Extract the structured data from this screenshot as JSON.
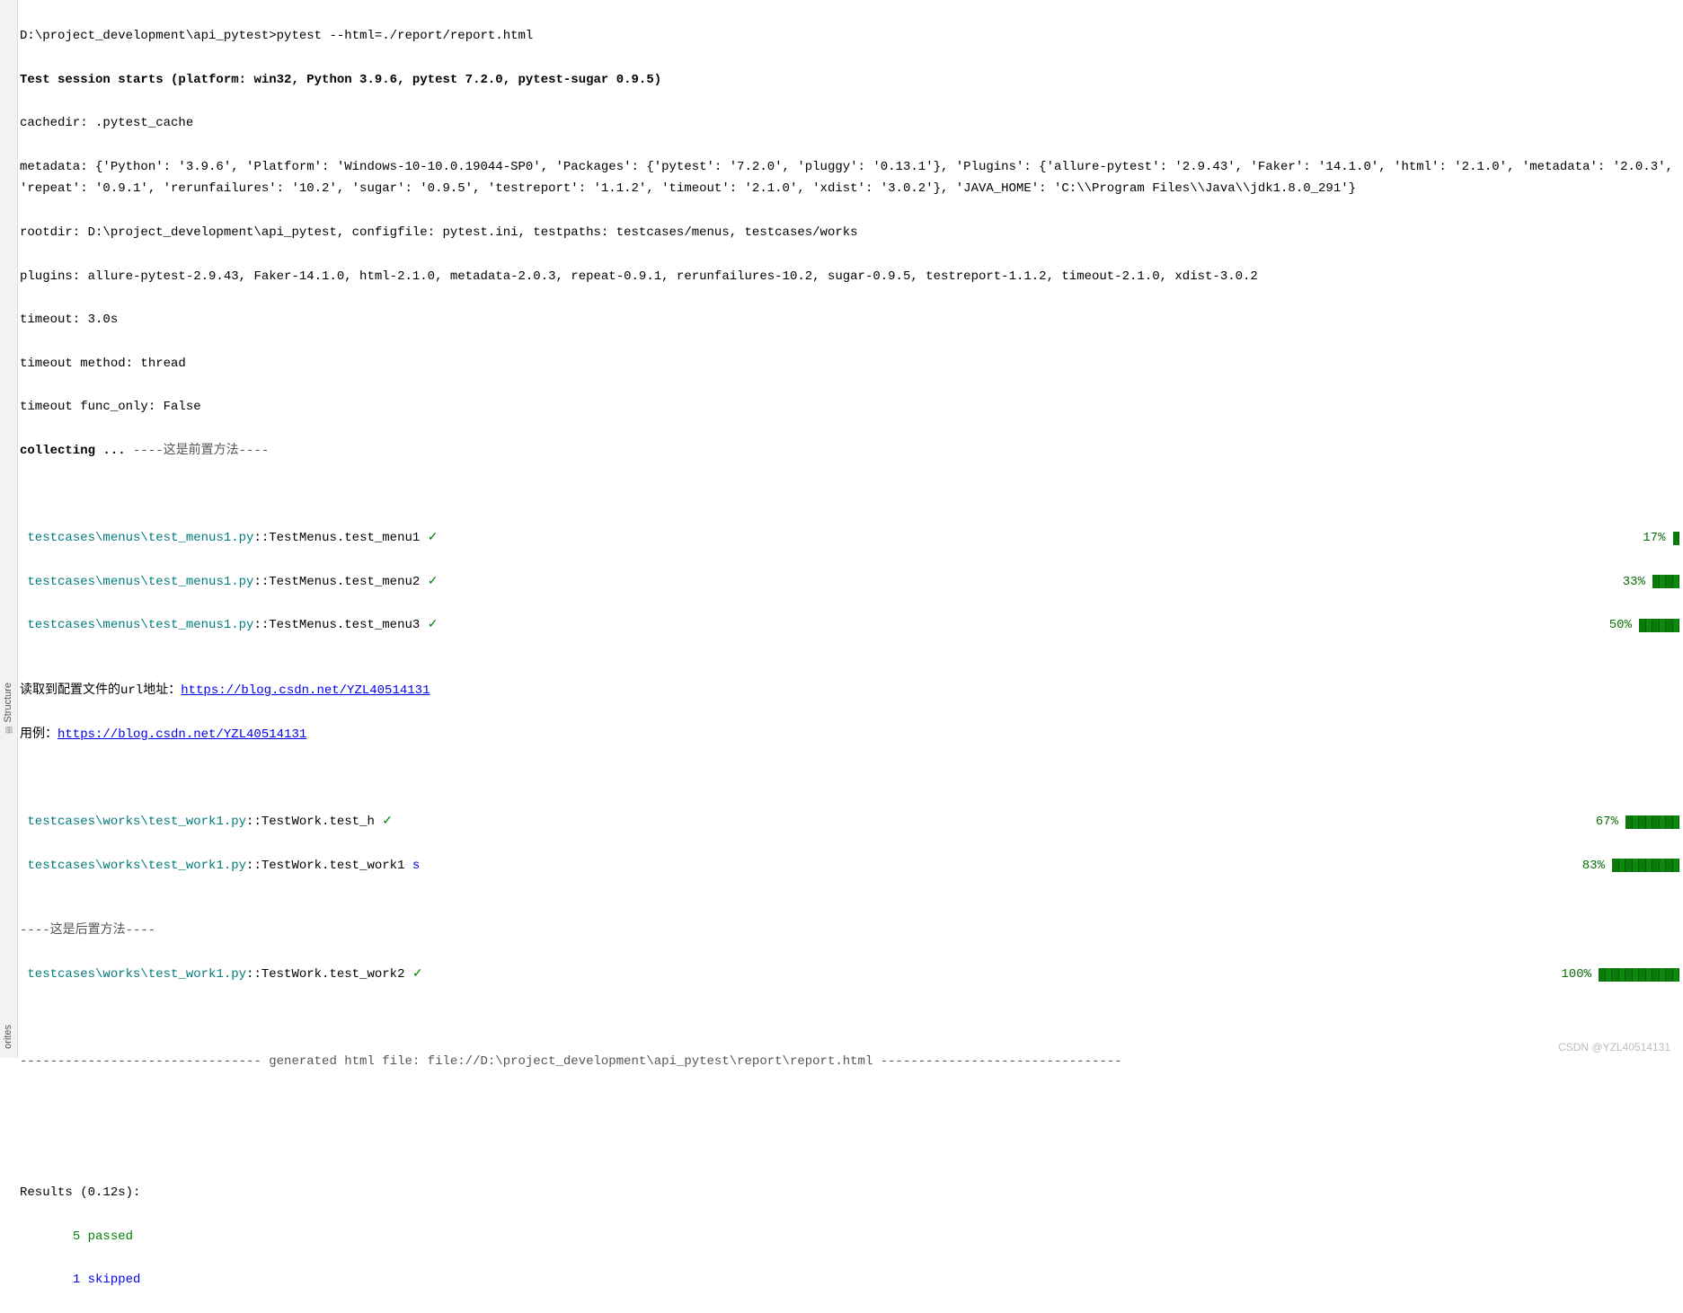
{
  "sidebar": {
    "structure": "Structure",
    "favorites": "orites"
  },
  "cmd": {
    "prompt": "D:\\project_development\\api_pytest>",
    "command": "pytest --html=./report/report.html"
  },
  "session": "Test session starts (platform: win32, Python 3.9.6, pytest 7.2.0, pytest-sugar 0.9.5)",
  "cachedir": "cachedir: .pytest_cache",
  "metadata": "metadata: {'Python': '3.9.6', 'Platform': 'Windows-10-10.0.19044-SP0', 'Packages': {'pytest': '7.2.0', 'pluggy': '0.13.1'}, 'Plugins': {'allure-pytest': '2.9.43', 'Faker': '14.1.0', 'html': '2.1.0', 'metadata': '2.0.3', 'repeat': '0.9.1', 'rerunfailures': '10.2', 'sugar': '0.9.5', 'testreport': '1.1.2', 'timeout': '2.1.0', 'xdist': '3.0.2'}, 'JAVA_HOME': 'C:\\\\Program Files\\\\Java\\\\jdk1.8.0_291'}",
  "rootdir": "rootdir: D:\\project_development\\api_pytest, configfile: pytest.ini, testpaths: testcases/menus, testcases/works",
  "plugins": "plugins: allure-pytest-2.9.43, Faker-14.1.0, html-2.1.0, metadata-2.0.3, repeat-0.9.1, rerunfailures-10.2, sugar-0.9.5, testreport-1.1.2, timeout-2.1.0, xdist-3.0.2",
  "timeout": "timeout: 3.0s",
  "timeout_method": "timeout method: thread",
  "timeout_func": "timeout func_only: False",
  "collecting": {
    "label": "collecting ... ",
    "msg": "----这是前置方法----"
  },
  "tests": [
    {
      "file": " testcases\\menus\\test_menus1.py",
      "node": "::TestMenus.test_menu1 ",
      "mark": "✓",
      "mark_color": "green",
      "pct": "17%",
      "segs": 1
    },
    {
      "file": " testcases\\menus\\test_menus1.py",
      "node": "::TestMenus.test_menu2 ",
      "mark": "✓",
      "mark_color": "green",
      "pct": "33%",
      "segs": 4
    },
    {
      "file": " testcases\\menus\\test_menus1.py",
      "node": "::TestMenus.test_menu3 ",
      "mark": "✓",
      "mark_color": "green",
      "pct": "50%",
      "segs": 6
    }
  ],
  "url_line": {
    "prefix": "读取到配置文件的url地址：",
    "url": "https://blog.csdn.net/YZL40514131"
  },
  "case_line": {
    "prefix": "用例：",
    "url": "https://blog.csdn.net/YZL40514131"
  },
  "tests2": [
    {
      "file": " testcases\\works\\test_work1.py",
      "node": "::TestWork.test_h ",
      "mark": "✓",
      "mark_color": "green",
      "pct": "67%",
      "segs": 8
    },
    {
      "file": " testcases\\works\\test_work1.py",
      "node": "::TestWork.test_work1 ",
      "mark": "s",
      "mark_color": "blue",
      "pct": "83%",
      "segs": 10
    }
  ],
  "teardown": "----这是后置方法----",
  "tests3": [
    {
      "file": " testcases\\works\\test_work1.py",
      "node": "::TestWork.test_work2 ",
      "mark": "✓",
      "mark_color": "green",
      "pct": "100%",
      "segs": 12
    }
  ],
  "generated": "-------------------------------- generated html file: file://D:\\project_development\\api_pytest\\report\\report.html --------------------------------",
  "results": {
    "header": "Results (0.12s):",
    "passed": {
      "count": "5",
      "label": " passed"
    },
    "skipped": {
      "count": "1",
      "label": " skipped"
    }
  },
  "watermark": "CSDN @YZL40514131"
}
